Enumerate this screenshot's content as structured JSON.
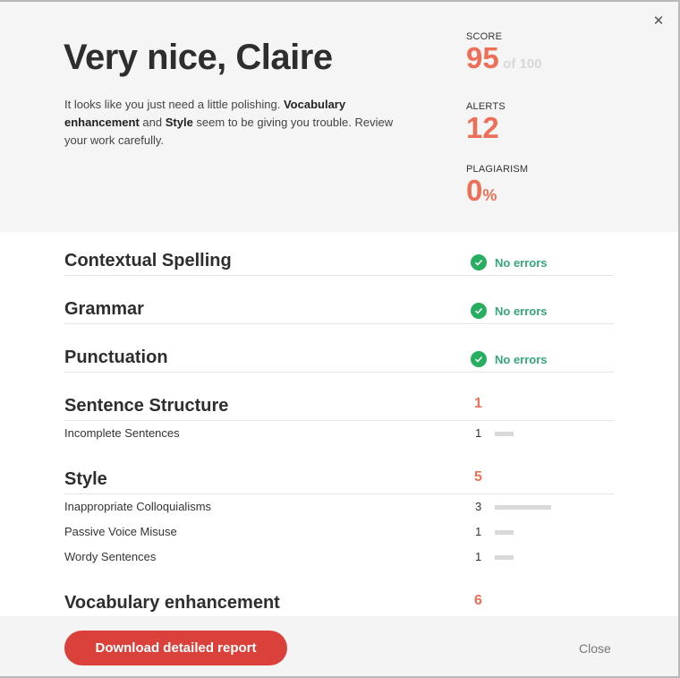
{
  "header": {
    "title": "Very nice, Claire",
    "summary_parts": {
      "p1": "It looks like you just need a little polishing. ",
      "b1": "Vocabulary enhancement",
      "p2": " and ",
      "b2": "Style",
      "p3": " seem to be giving you trouble. Review your work carefully."
    },
    "close_icon": "close-x-icon"
  },
  "stats": {
    "score": {
      "label": "SCORE",
      "value": "95",
      "suffix": "of 100"
    },
    "alerts": {
      "label": "ALERTS",
      "value": "12"
    },
    "plagiarism": {
      "label": "PLAGIARISM",
      "value": "0",
      "unit": "%"
    }
  },
  "sections": [
    {
      "title": "Contextual Spelling",
      "status": "No errors",
      "icon": "check-circle-icon"
    },
    {
      "title": "Grammar",
      "status": "No errors",
      "icon": "check-circle-icon"
    },
    {
      "title": "Punctuation",
      "status": "No errors",
      "icon": "check-circle-icon"
    },
    {
      "title": "Sentence Structure",
      "count": "1",
      "items": [
        {
          "label": "Incomplete Sentences",
          "count": 1
        }
      ]
    },
    {
      "title": "Style",
      "count": "5",
      "items": [
        {
          "label": "Inappropriate Colloquialisms",
          "count": 3
        },
        {
          "label": "Passive Voice Misuse",
          "count": 1
        },
        {
          "label": "Wordy Sentences",
          "count": 1
        }
      ]
    },
    {
      "title": "Vocabulary enhancement",
      "count": "6"
    }
  ],
  "footer": {
    "download_label": "Download detailed report",
    "close_label": "Close"
  },
  "colors": {
    "accent": "#ee6f57",
    "button": "#d9413a",
    "success": "#27ae60"
  }
}
